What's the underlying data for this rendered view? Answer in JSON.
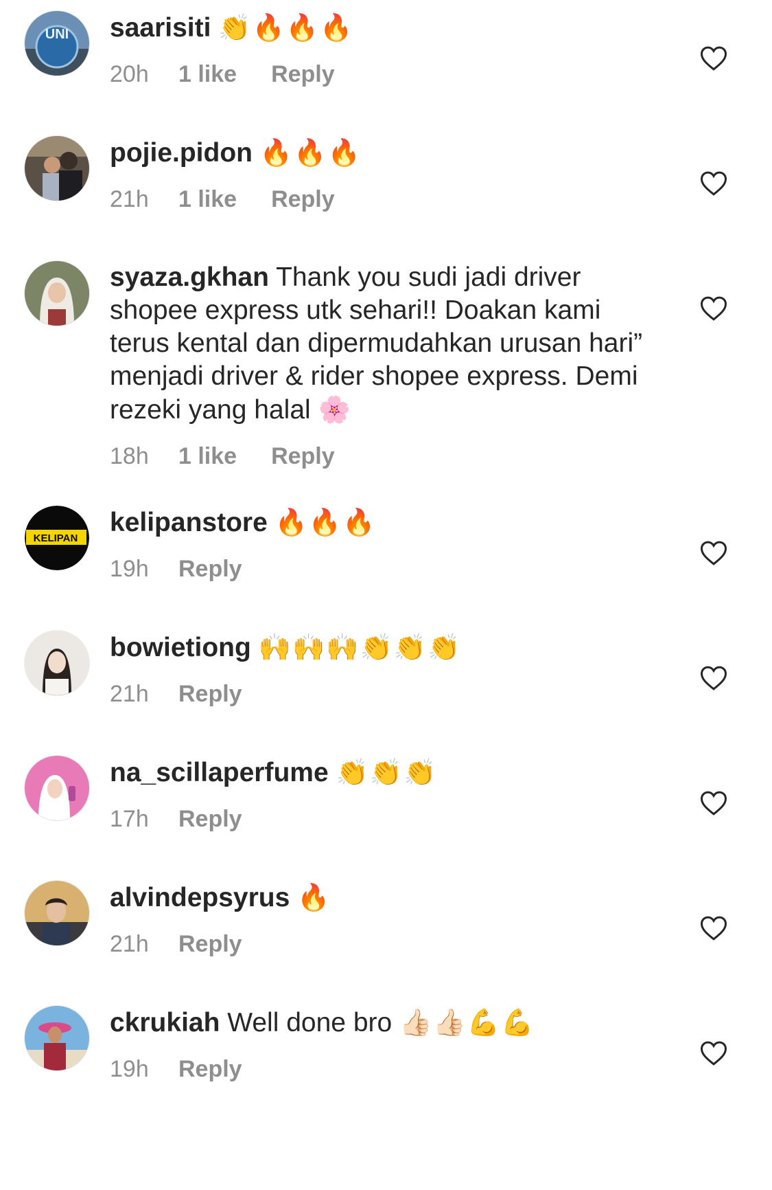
{
  "comments": [
    {
      "username": "saarisiti",
      "text": "",
      "emojis": "👏🔥🔥🔥",
      "time": "20h",
      "likes": "1 like",
      "reply": "Reply"
    },
    {
      "username": "pojie.pidon",
      "text": "",
      "emojis": "🔥🔥🔥",
      "time": "21h",
      "likes": "1 like",
      "reply": "Reply"
    },
    {
      "username": "syaza.gkhan",
      "text": "Thank you sudi jadi driver shopee express utk sehari!! Doakan kami terus kental dan dipermudahkan urusan hari” menjadi driver & rider shopee express. Demi rezeki yang halal",
      "emojis": "🌸",
      "time": "18h",
      "likes": "1 like",
      "reply": "Reply"
    },
    {
      "username": "kelipanstore",
      "text": "",
      "emojis": "🔥🔥🔥",
      "time": "19h",
      "likes": "",
      "reply": "Reply",
      "avatar_text": "KELIPAN"
    },
    {
      "username": "bowietiong",
      "text": "",
      "emojis": "🙌🙌🙌👏👏👏",
      "time": "21h",
      "likes": "",
      "reply": "Reply"
    },
    {
      "username": "na_scillaperfume",
      "text": "",
      "emojis": "👏👏👏",
      "time": "17h",
      "likes": "",
      "reply": "Reply"
    },
    {
      "username": "alvindepsyrus",
      "text": "",
      "emojis": "🔥",
      "time": "21h",
      "likes": "",
      "reply": "Reply"
    },
    {
      "username": "ckrukiah",
      "text": "Well done bro",
      "emojis": "👍🏻👍🏻💪💪",
      "time": "19h",
      "likes": "",
      "reply": "Reply"
    }
  ],
  "avatars": {
    "saarisiti": "UNI",
    "kelipanstore": "KELIPAN"
  },
  "colors": {
    "text": "#262626",
    "meta": "#8e8e8e",
    "heart": "#262626"
  }
}
